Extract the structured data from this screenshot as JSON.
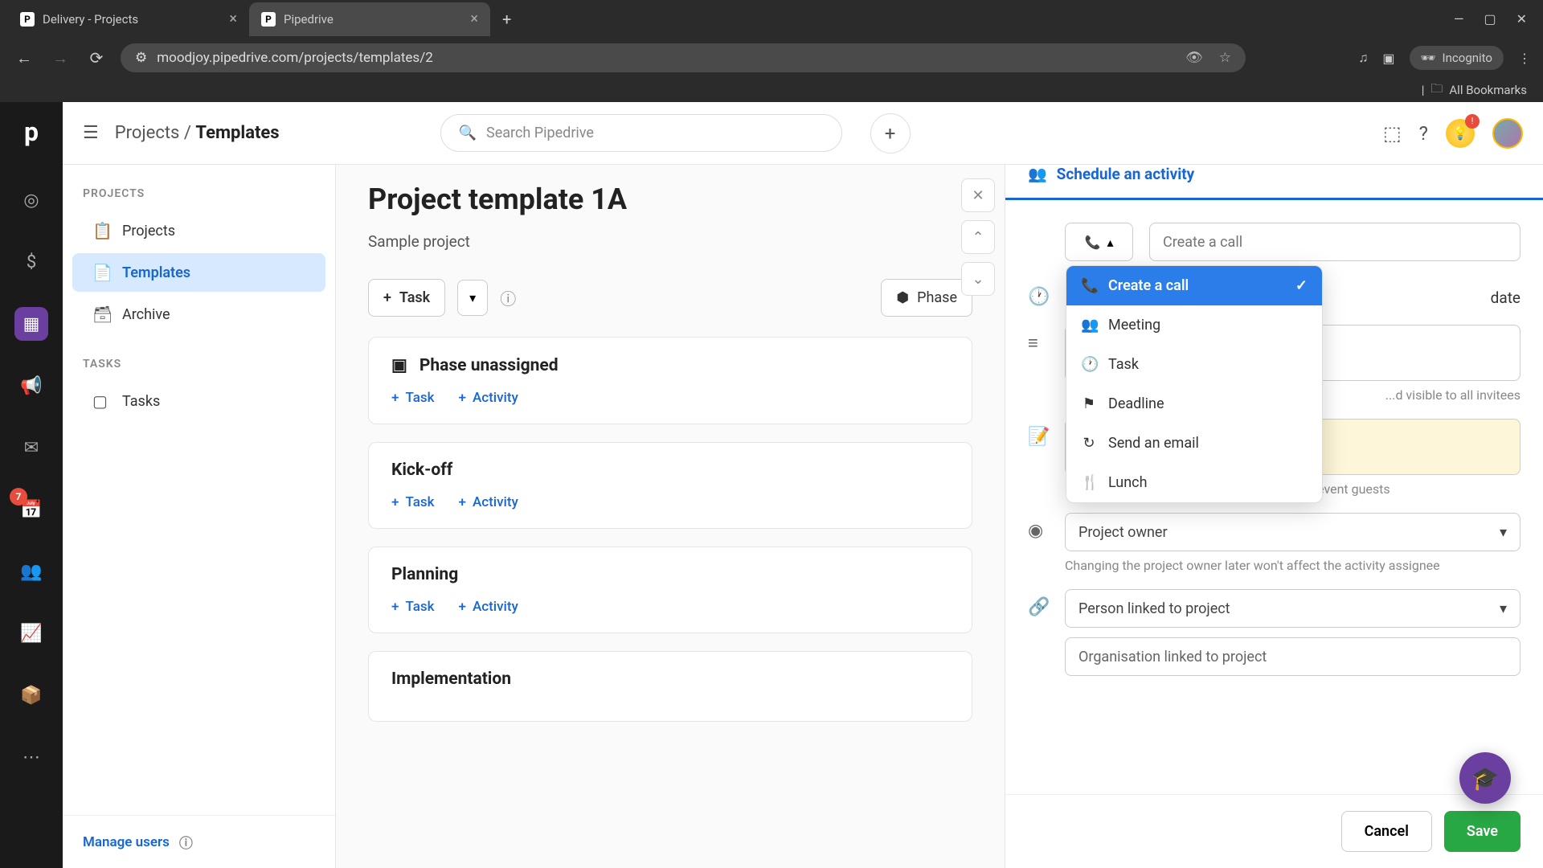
{
  "browser": {
    "tabs": [
      {
        "title": "Delivery - Projects"
      },
      {
        "title": "Pipedrive"
      }
    ],
    "url": "moodjoy.pipedrive.com/projects/templates/2",
    "incognito_label": "Incognito",
    "all_bookmarks": "All Bookmarks"
  },
  "header": {
    "breadcrumb_parent": "Projects",
    "breadcrumb_sep": "/",
    "breadcrumb_current": "Templates",
    "search_placeholder": "Search Pipedrive"
  },
  "sidebar": {
    "section1_title": "PROJECTS",
    "items1": [
      {
        "label": "Projects"
      },
      {
        "label": "Templates"
      },
      {
        "label": "Archive"
      }
    ],
    "section2_title": "TASKS",
    "items2": [
      {
        "label": "Tasks"
      }
    ],
    "manage_users": "Manage users"
  },
  "rail": {
    "badge": "7"
  },
  "main": {
    "title": "Project template 1A",
    "subtitle": "Sample project",
    "task_btn": "Task",
    "phase_btn": "Phase",
    "phases": [
      {
        "title": "Phase unassigned"
      },
      {
        "title": "Kick-off"
      },
      {
        "title": "Planning"
      },
      {
        "title": "Implementation"
      }
    ],
    "add_task": "Task",
    "add_activity": "Activity"
  },
  "panel": {
    "title": "Schedule an activity",
    "title_input_placeholder": "Create a call",
    "date_label": "date",
    "desc_helper": "...d visible to all invitees",
    "notes_helper": "Notes are visible within Pipedrive, but not to event guests",
    "owner_placeholder": "Project owner",
    "owner_helper": "Changing the project owner later won't affect the activity assignee",
    "person_placeholder": "Person linked to project",
    "org_placeholder": "Organisation linked to project",
    "cancel": "Cancel",
    "save": "Save",
    "activity_types": [
      {
        "label": "Create a call",
        "icon": "phone"
      },
      {
        "label": "Meeting",
        "icon": "users"
      },
      {
        "label": "Task",
        "icon": "clock"
      },
      {
        "label": "Deadline",
        "icon": "flag"
      },
      {
        "label": "Send an email",
        "icon": "mail"
      },
      {
        "label": "Lunch",
        "icon": "food"
      }
    ]
  }
}
